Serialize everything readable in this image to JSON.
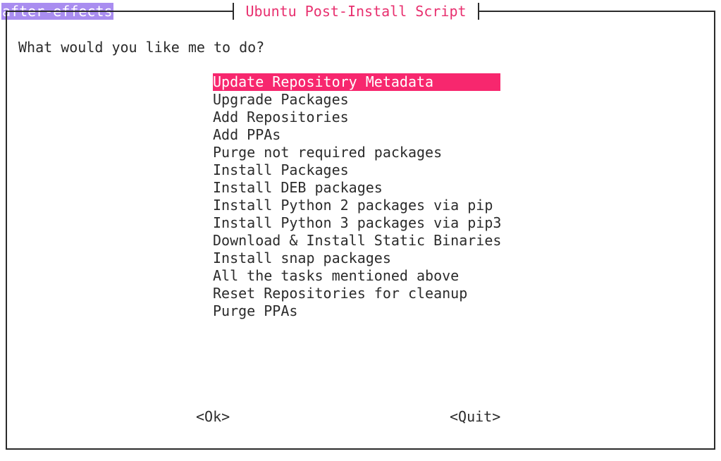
{
  "terminal": {
    "tag": "after-effects"
  },
  "dialog": {
    "title": "Ubuntu Post-Install Script",
    "prompt": "What would you like me to do?",
    "selected_index": 0,
    "menu": [
      "Update Repository Metadata",
      "Upgrade Packages",
      "Add Repositories",
      "Add PPAs",
      "Purge not required packages",
      "Install Packages",
      "Install DEB packages",
      "Install Python 2 packages via pip",
      "Install Python 3 packages via pip3",
      "Download & Install Static Binaries",
      "Install snap packages",
      "All the tasks mentioned above",
      "Reset Repositories for cleanup",
      "Purge PPAs"
    ],
    "ok_label": "<Ok>",
    "quit_label": "<Quit>"
  },
  "colors": {
    "tag_bg": "#a98df0",
    "accent": "#f7276e",
    "title_fg": "#e8306f",
    "text": "#2b2b2b"
  }
}
